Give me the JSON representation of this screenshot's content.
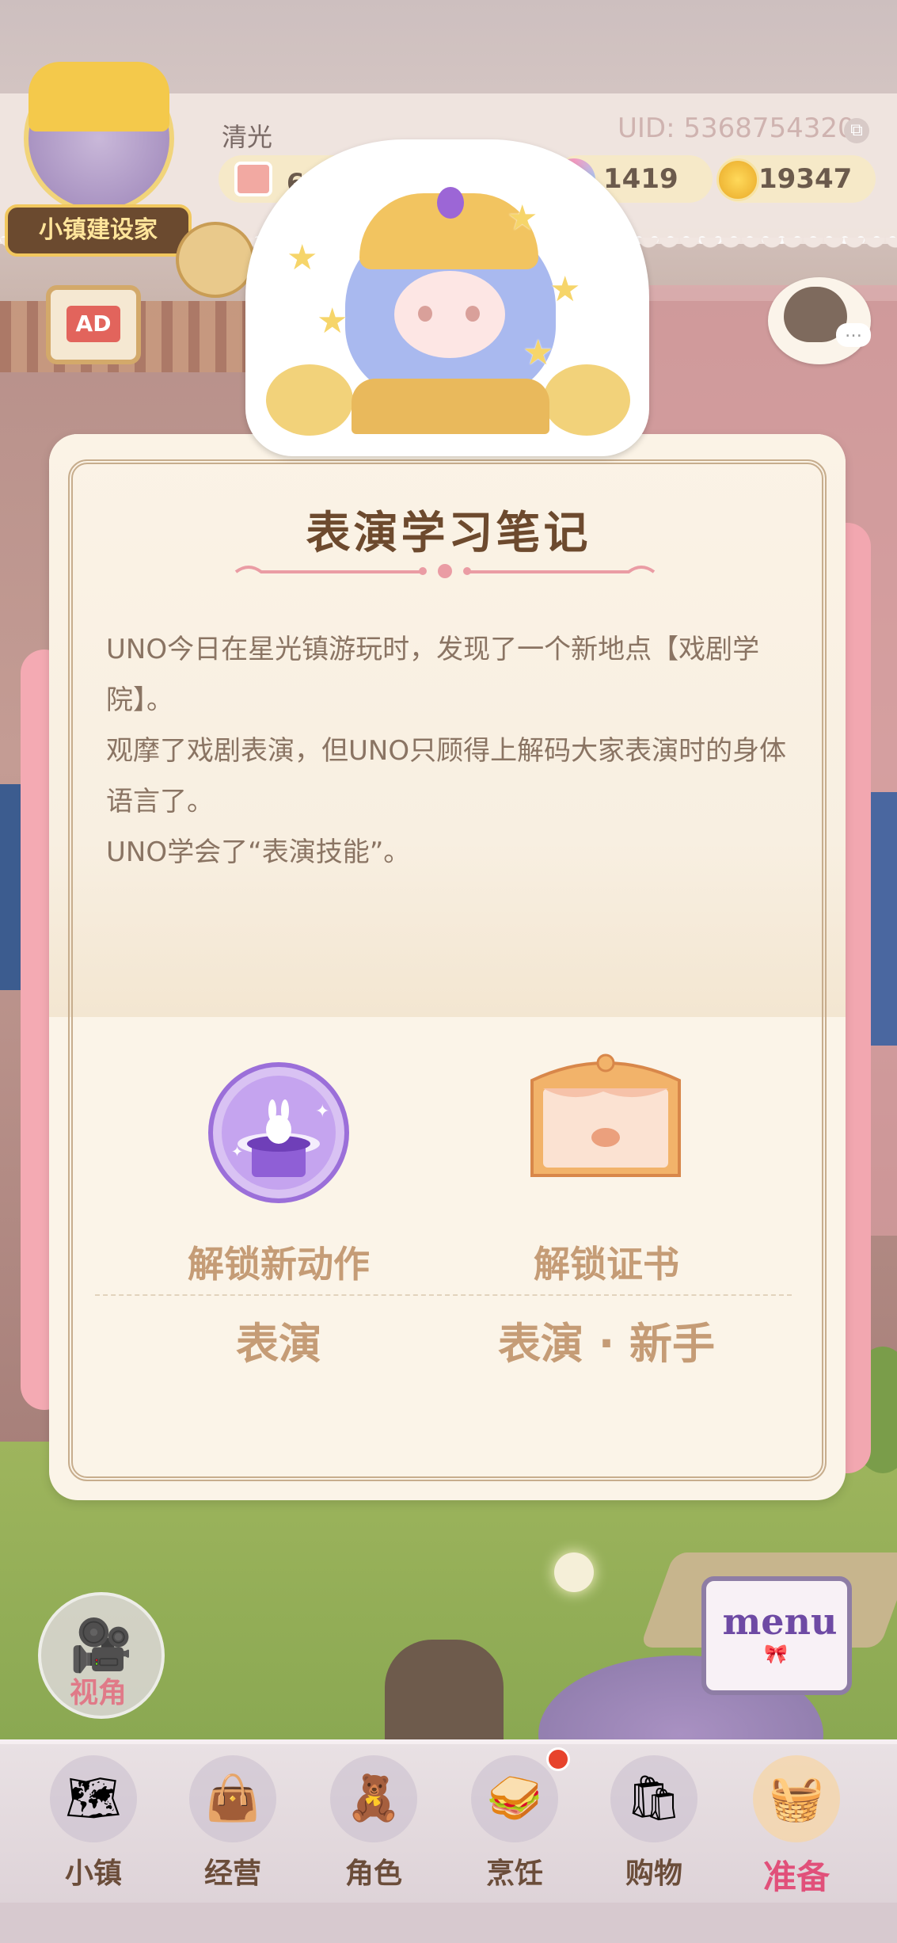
{
  "header": {
    "player_name": "清光",
    "uid": "UID: 5368754320",
    "date": "6月29日",
    "gems": "1419",
    "coins": "19347",
    "avatar_title": "小镇建设家",
    "ad_label": "AD"
  },
  "modal": {
    "title": "表演学习笔记",
    "paragraphs": [
      "UNO今日在星光镇游玩时，发现了一个新地点【戏剧学院】。",
      "观摩了戏剧表演，但UNO只顾得上解码大家表演时的身体语言了。",
      "UNO学会了“表演技能”。"
    ],
    "rewards": [
      {
        "label": "解锁新动作",
        "value": "表演",
        "icon": "magic-hat-icon"
      },
      {
        "label": "解锁证书",
        "value": "表演 · 新手",
        "icon": "stage-certificate-icon"
      }
    ]
  },
  "controls": {
    "view_label": "视角",
    "menu_label": "menu"
  },
  "nav": {
    "items": [
      {
        "label": "小镇",
        "icon": "map-icon"
      },
      {
        "label": "经营",
        "icon": "shop-bag-icon"
      },
      {
        "label": "角色",
        "icon": "character-icon"
      },
      {
        "label": "烹饪",
        "icon": "cooking-icon"
      },
      {
        "label": "购物",
        "icon": "shopping-bag-icon"
      },
      {
        "label": "准备",
        "icon": "picnic-basket-icon"
      }
    ],
    "active": "准备"
  },
  "colors": {
    "accent_pink": "#e1507a",
    "modal_bg": "#fbf4e8",
    "title_brown": "#6d4a2e",
    "reward_tan": "#c59c76"
  }
}
